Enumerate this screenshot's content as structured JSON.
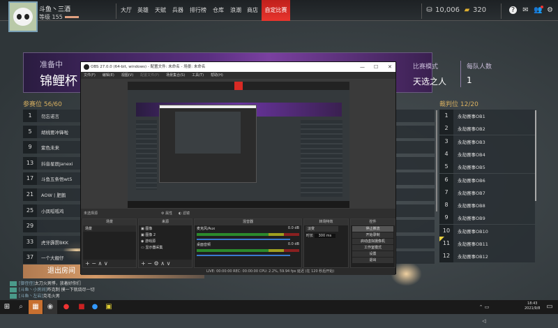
{
  "user": {
    "name": "斗鱼丶三酒",
    "level": "等级 155"
  },
  "nav": [
    "大厅",
    "英雄",
    "天赋",
    "兵器",
    "排行榜",
    "仓库",
    "浪潮",
    "商店",
    "自定比赛"
  ],
  "currency": {
    "coins": "10,006",
    "gold": "320"
  },
  "banner": {
    "status": "准备中",
    "title": "锦鲤杯",
    "mode_label": "比赛模式",
    "mode_value": "天选之人",
    "team_label": "每队人数",
    "team_value": "1"
  },
  "players": {
    "header": "参赛位 56/60",
    "rows": [
      [
        "1",
        "勿忘诺言"
      ],
      [
        "5",
        "胡桃要冲锋啦"
      ],
      [
        "9",
        "紫色未来"
      ],
      [
        "13",
        "抖音星辰Janexi"
      ],
      [
        "17",
        "斗鱼五条悟wt5"
      ],
      [
        "21",
        "AOW丨肥鹅"
      ],
      [
        "25",
        "小凤呱呱鸡"
      ],
      [
        "29",
        ""
      ],
      [
        "33",
        "虎牙霹雳BKK"
      ],
      [
        "37",
        "一个大靓仔"
      ]
    ]
  },
  "referees": {
    "header": "裁判位 12/20",
    "rows": [
      [
        "1",
        "永劫赛事OB1"
      ],
      [
        "2",
        "永劫赛事OB2"
      ],
      [
        "3",
        "永劫赛事OB3"
      ],
      [
        "4",
        "永劫赛事OB4"
      ],
      [
        "5",
        "永劫赛事OB5"
      ],
      [
        "6",
        "永劫赛事OB6"
      ],
      [
        "7",
        "永劫赛事OB7"
      ],
      [
        "8",
        "永劫赛事OB8"
      ],
      [
        "9",
        "永劫赛事OB9"
      ],
      [
        "10",
        "永劫赛事OB10"
      ],
      [
        "11",
        "永劫赛事OB11"
      ],
      [
        "12",
        "永劫赛事OB12"
      ]
    ]
  },
  "exit_label": "退出房间",
  "obs": {
    "title": "OBS 27.0.0 (64-bit, windows) - 配置文件: 未命名 - 场景: 未命名",
    "menu": [
      "文件(F)",
      "编辑(E)",
      "视图(V)",
      "配置文件(P)",
      "场景集合(S)",
      "工具(T)",
      "帮助(H)"
    ],
    "no_source": "未选择源",
    "props": "属性",
    "filters": "滤镜",
    "docks": {
      "scenes": "场景",
      "sources": "来源",
      "mixer": "混音器",
      "transitions": "转场特效",
      "controls": "控件"
    },
    "scene_item": "场景",
    "sources": [
      "图像",
      "图像 2",
      "游戏源",
      "显示器采集"
    ],
    "mixer": [
      {
        "name": "麦克风/Aux",
        "db": "0.0 dB"
      },
      {
        "name": "桌面音频",
        "db": "0.0 dB"
      }
    ],
    "transition": "淡变",
    "duration_label": "时长",
    "duration": "300 ms",
    "controls": [
      "停止推流",
      "开始录制",
      "启动虚拟摄像机",
      "工作室模式",
      "设置",
      "退出"
    ],
    "status": "LIVE: 00:00:00   REC: 00:00:00   CPU: 2.2%, 59.94 fps   延迟 (在 120 秒后开始)"
  },
  "chat": [
    [
      "[御侄侄]",
      "太刀火男悸，放着好你们"
    ],
    [
      "[斗鱼丶小房间]",
      "咋克制 摸一下就烧尽一切"
    ],
    [
      "[斗鱼丶左岩]",
      "克毛火男"
    ]
  ],
  "clock": {
    "time": "18:43",
    "date": "2021/9/8"
  },
  "colors": {
    "accent": "#e8352d",
    "gold": "#d8b060",
    "banner": "#5a2f80"
  }
}
